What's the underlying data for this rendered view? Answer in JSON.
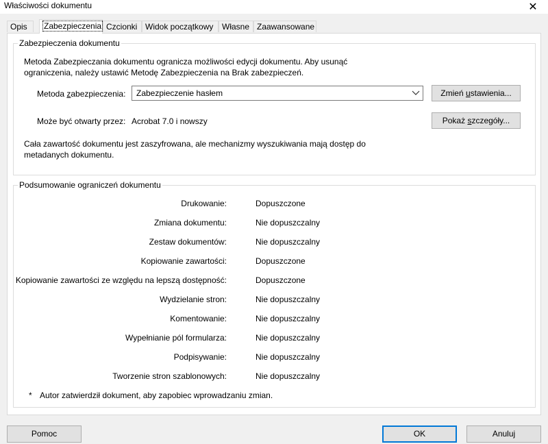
{
  "window": {
    "title": "Właściwości dokumentu"
  },
  "tabs": [
    {
      "label": "Opis"
    },
    {
      "label": "Zabezpieczenia"
    },
    {
      "label": "Czcionki"
    },
    {
      "label": "Widok początkowy"
    },
    {
      "label": "Własne"
    },
    {
      "label": "Zaawansowane"
    }
  ],
  "security": {
    "group_title": "Zabezpieczenia dokumentu",
    "description_line1": "Metoda Zabezpieczania dokumentu ogranicza możliwości edycji dokumentu. Aby usunąć",
    "description_line2": "ograniczenia, należy ustawić Metodę Zabezpieczenia na Brak zabezpieczeń.",
    "method_label_pre": "Metoda ",
    "method_label_ul": "z",
    "method_label_post": "abezpieczenia:",
    "method_value": "Zabezpieczenie hasłem",
    "change_settings_pre": "Zmień ",
    "change_settings_ul": "u",
    "change_settings_post": "stawienia...",
    "opened_by_label": "Może być otwarty przez:",
    "opened_by_value": "Acrobat 7.0 i nowszy",
    "show_details_pre": "Pokaż ",
    "show_details_ul": "s",
    "show_details_post": "zczegóły...",
    "encryption_note_line1": "Cała zawartość dokumentu jest zaszyfrowana, ale mechanizmy wyszukiwania mają dostęp do",
    "encryption_note_line2": "metadanych dokumentu."
  },
  "restrictions": {
    "group_title": "Podsumowanie ograniczeń dokumentu",
    "rows": [
      {
        "label": "Drukowanie:",
        "value": "Dopuszczone"
      },
      {
        "label": "Zmiana dokumentu:",
        "value": "Nie dopuszczalny"
      },
      {
        "label": "Zestaw dokumentów:",
        "value": "Nie dopuszczalny"
      },
      {
        "label": "Kopiowanie zawartości:",
        "value": "Dopuszczone"
      },
      {
        "label": "Kopiowanie zawartości ze względu na lepszą dostępność:",
        "value": "Dopuszczone"
      },
      {
        "label": "Wydzielanie stron:",
        "value": "Nie dopuszczalny"
      },
      {
        "label": "Komentowanie:",
        "value": "Nie dopuszczalny"
      },
      {
        "label": "Wypełnianie pól formularza:",
        "value": "Nie dopuszczalny"
      },
      {
        "label": "Podpisywanie:",
        "value": "Nie dopuszczalny"
      },
      {
        "label": "Tworzenie stron szablonowych:",
        "value": "Nie dopuszczalny"
      }
    ],
    "footnote_marker": "*",
    "footnote": "Autor zatwierdził dokument, aby zapobiec wprowadzaniu zmian."
  },
  "footer": {
    "help_label": "Pomoc",
    "ok_label": "OK",
    "cancel_label": "Anuluj"
  },
  "colors": {
    "accent": "#0078d7",
    "panel_bg": "#ffffff",
    "window_bg": "#f0f0f0"
  }
}
